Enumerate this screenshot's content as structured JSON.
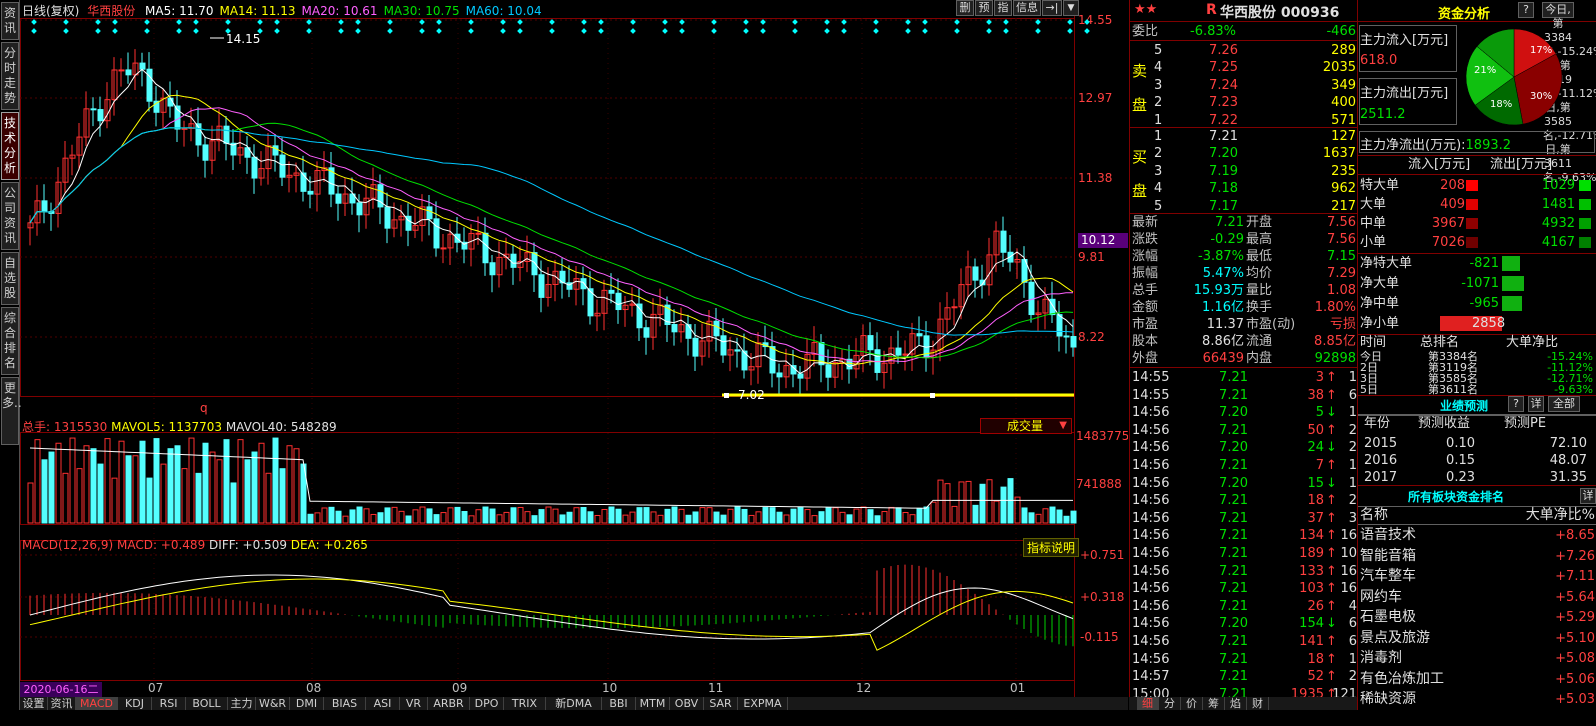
{
  "leftnav": [
    "资讯",
    "分时走势",
    "技术分析",
    "公司资讯",
    "自选股",
    "综合排名",
    "更多.."
  ],
  "chart": {
    "period": "日线(复权)",
    "stock": "华西股份",
    "ma": [
      {
        "label": "MA5: 11.70",
        "color": "#ffffff"
      },
      {
        "label": "MA14: 11.13",
        "color": "#ffff00"
      },
      {
        "label": "MA20: 10.61",
        "color": "#ff60ff"
      },
      {
        "label": "MA30: 10.75",
        "color": "#00e000"
      },
      {
        "label": "MA60: 10.04",
        "color": "#00c8ff"
      }
    ],
    "tools": [
      "删",
      "预",
      "指",
      "信息"
    ],
    "price_axis": [
      "14.55",
      "12.97",
      "11.38",
      "9.81",
      "8.22"
    ],
    "current_price": "10.12",
    "high_label": "14.15",
    "low_label": "7.02",
    "q_label": "q",
    "vol": {
      "label": "总手: 1315530",
      "mavol5": "MAVOL5: 1137703",
      "mavol40": "MAVOL40: 548289",
      "axis": [
        "1483775",
        "741888"
      ],
      "dropdown": "成交量"
    },
    "macd": {
      "label": "MACD(12,26,9)",
      "macd": "MACD: +0.489",
      "diff": "DIFF: +0.509",
      "dea": "DEA: +0.265",
      "axis": [
        "+0.751",
        "+0.318",
        "-0.115"
      ],
      "help": "指标说明"
    },
    "months": [
      "06",
      "07",
      "08",
      "09",
      "10",
      "11",
      "12",
      "01"
    ],
    "cursor_date": "2020-06-16二",
    "tabs": [
      "设置",
      "资讯",
      "MACD",
      "KDJ",
      "RSI",
      "BOLL",
      "主力",
      "W&R",
      "DMI",
      "BIAS",
      "ASI",
      "VR",
      "ARBR",
      "DPO",
      "TRIX",
      "新DMA",
      "BBI",
      "MTM",
      "OBV",
      "SAR",
      "EXPMA"
    ],
    "active_tab": "MACD"
  },
  "quote": {
    "title": "华西股份 000936",
    "stars": "★★",
    "rmark": "R",
    "weibi_label": "委比",
    "weibi": "-6.83%",
    "weicha": "-466",
    "sell_label": [
      "卖",
      "盘"
    ],
    "buy_label": [
      "买",
      "盘"
    ],
    "sell": [
      [
        "5",
        "7.26",
        "289"
      ],
      [
        "4",
        "7.25",
        "2035"
      ],
      [
        "3",
        "7.24",
        "349"
      ],
      [
        "2",
        "7.23",
        "400"
      ],
      [
        "1",
        "7.22",
        "571"
      ]
    ],
    "buy": [
      [
        "1",
        "7.21",
        "127"
      ],
      [
        "2",
        "7.20",
        "1637"
      ],
      [
        "3",
        "7.19",
        "235"
      ],
      [
        "4",
        "7.18",
        "962"
      ],
      [
        "5",
        "7.17",
        "217"
      ]
    ],
    "stats": [
      [
        "最新",
        "7.21",
        "开盘",
        "7.56"
      ],
      [
        "涨跌",
        "-0.29",
        "最高",
        "7.56"
      ],
      [
        "涨幅",
        "-3.87%",
        "最低",
        "7.15"
      ],
      [
        "振幅",
        "5.47%",
        "均价",
        "7.29"
      ],
      [
        "总手",
        "15.93万",
        "量比",
        "1.08"
      ],
      [
        "金额",
        "1.16亿",
        "换手",
        "1.80%"
      ],
      [
        "市盈",
        "11.37",
        "市盈(动)",
        "亏损"
      ],
      [
        "股本",
        "8.86亿",
        "流通",
        "8.85亿"
      ],
      [
        "外盘",
        "66439",
        "内盘",
        "92898"
      ]
    ],
    "ticks": [
      [
        "14:55",
        "7.21",
        "3",
        "1"
      ],
      [
        "14:55",
        "7.21",
        "38",
        "6"
      ],
      [
        "14:56",
        "7.20",
        "5",
        "1"
      ],
      [
        "14:56",
        "7.21",
        "50",
        "2"
      ],
      [
        "14:56",
        "7.20",
        "24",
        "2"
      ],
      [
        "14:56",
        "7.21",
        "7",
        "1"
      ],
      [
        "14:56",
        "7.20",
        "15",
        "1"
      ],
      [
        "14:56",
        "7.21",
        "18",
        "2"
      ],
      [
        "14:56",
        "7.21",
        "37",
        "3"
      ],
      [
        "14:56",
        "7.21",
        "134",
        "16"
      ],
      [
        "14:56",
        "7.21",
        "189",
        "10"
      ],
      [
        "14:56",
        "7.21",
        "133",
        "16"
      ],
      [
        "14:56",
        "7.21",
        "103",
        "16"
      ],
      [
        "14:56",
        "7.21",
        "26",
        "4"
      ],
      [
        "14:56",
        "7.20",
        "154",
        "6"
      ],
      [
        "14:56",
        "7.21",
        "141",
        "6"
      ],
      [
        "14:56",
        "7.21",
        "18",
        "1"
      ],
      [
        "14:57",
        "7.21",
        "52",
        "2"
      ],
      [
        "15:00",
        "7.21",
        "1935",
        "121"
      ]
    ],
    "tabs": [
      "细",
      "分",
      "价",
      "筹",
      "焰",
      "财"
    ]
  },
  "fund": {
    "title": "资金分析",
    "help": "?",
    "rank": [
      [
        "今日",
        "第3384名",
        "-15.24%"
      ],
      [
        "2日",
        "第3119名",
        "-11.12%"
      ],
      [
        "3日",
        "第3585名",
        "-12.71%"
      ],
      [
        "5日",
        "第3611名",
        "-9.63%"
      ]
    ],
    "inflow_label": "主力流入[万元]",
    "inflow": "618.0",
    "outflow_label": "主力流出[万元]",
    "outflow": "2511.2",
    "net_label": "主力净流出(万元):",
    "net": "1893.2",
    "pie": [
      "17%",
      "30%",
      "18%",
      "21%"
    ],
    "table_head": [
      "流入[万元]",
      "流出[万元]"
    ],
    "table": [
      [
        "特大单",
        "208",
        "1029"
      ],
      [
        "大单",
        "409",
        "1481"
      ],
      [
        "中单",
        "3967",
        "4932"
      ],
      [
        "小单",
        "7026",
        "4167"
      ]
    ],
    "net_rows": [
      [
        "净特大单",
        "-821"
      ],
      [
        "净大单",
        "-1071"
      ],
      [
        "净中单",
        "-965"
      ],
      [
        "净小单",
        "2858"
      ]
    ],
    "rank_head": [
      "时间",
      "总排名",
      "大单净比"
    ],
    "forecast_title": "业绩预测",
    "forecast_btns": [
      "?",
      "详",
      "全部"
    ],
    "forecast_head": [
      "年份",
      "预测收益",
      "预测PE"
    ],
    "forecast": [
      [
        "2015",
        "0.10",
        "72.10"
      ],
      [
        "2016",
        "0.15",
        "48.07"
      ],
      [
        "2017",
        "0.23",
        "31.35"
      ]
    ],
    "sector_title": "所有板块资金排名",
    "sector_btn": "详",
    "sector_head": [
      "名称",
      "大单净比%"
    ],
    "sectors": [
      [
        "语音技术",
        "+8.65"
      ],
      [
        "智能音箱",
        "+7.26"
      ],
      [
        "汽车整车",
        "+7.11"
      ],
      [
        "网约车",
        "+5.64"
      ],
      [
        "石墨电极",
        "+5.29"
      ],
      [
        "景点及旅游",
        "+5.10"
      ],
      [
        "消毒剂",
        "+5.08"
      ],
      [
        "有色冶炼加工",
        "+5.06"
      ],
      [
        "稀缺资源",
        "+5.03"
      ]
    ]
  }
}
